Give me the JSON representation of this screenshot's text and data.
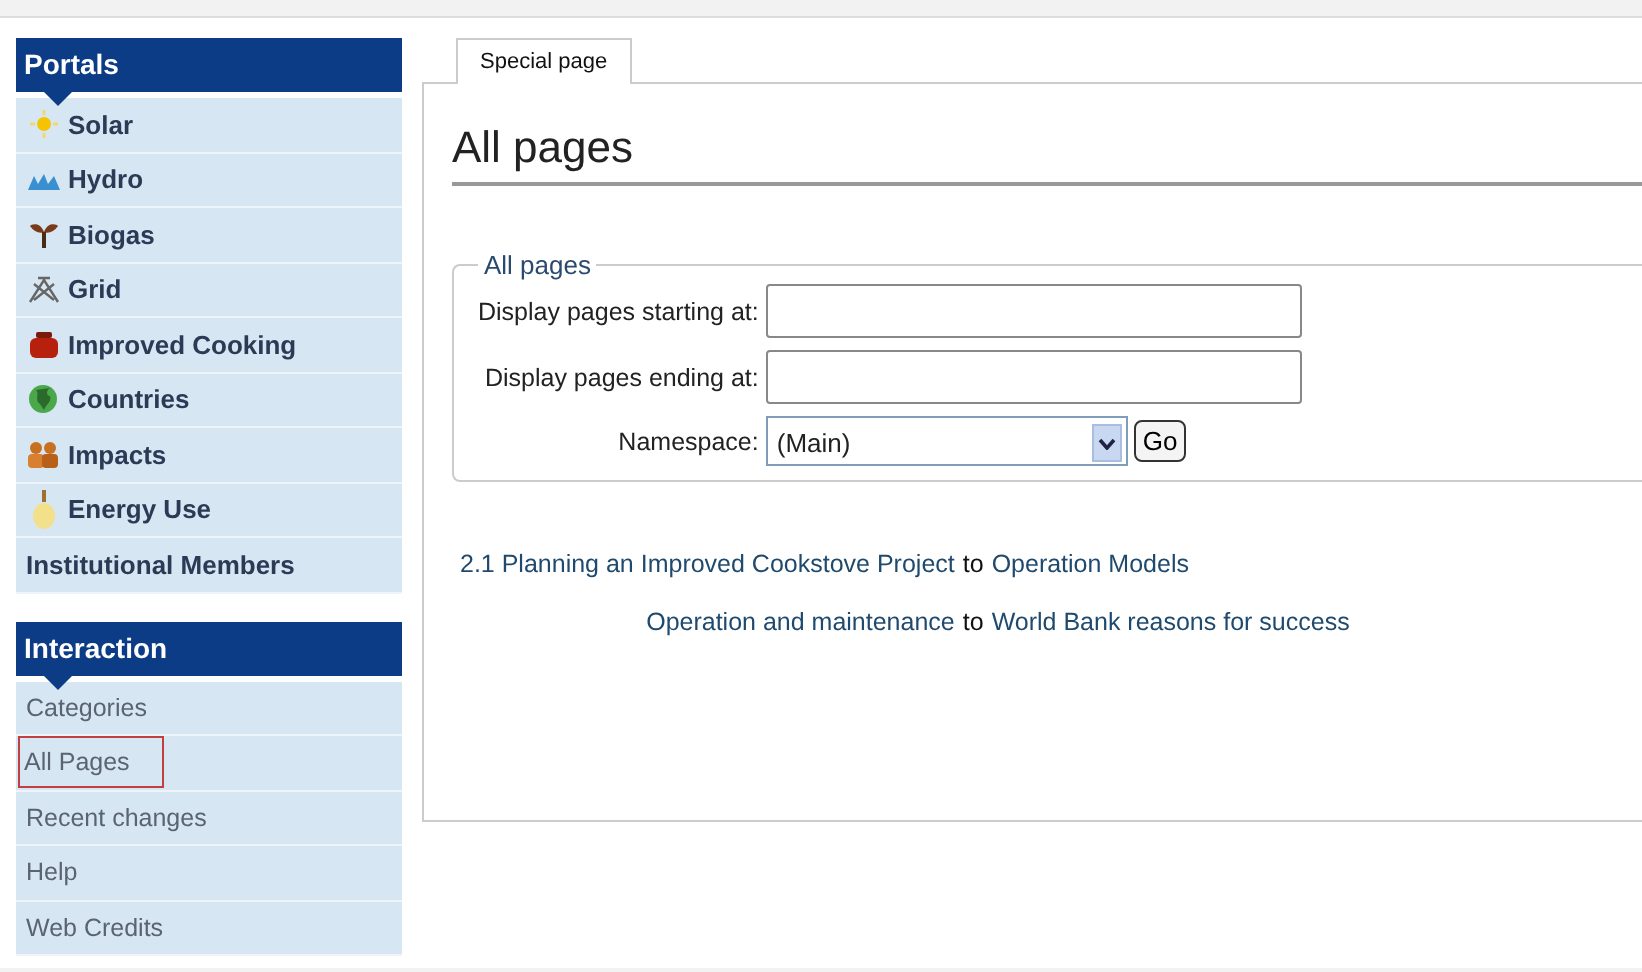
{
  "sidebar": {
    "portals": {
      "title": "Portals",
      "items": [
        {
          "label": "Solar"
        },
        {
          "label": "Hydro"
        },
        {
          "label": "Biogas"
        },
        {
          "label": "Grid"
        },
        {
          "label": "Improved Cooking"
        },
        {
          "label": "Countries"
        },
        {
          "label": "Impacts"
        },
        {
          "label": "Energy Use"
        },
        {
          "label": "Institutional Members"
        }
      ]
    },
    "interaction": {
      "title": "Interaction",
      "items": [
        {
          "label": "Categories",
          "highlighted": false
        },
        {
          "label": "All Pages",
          "highlighted": true
        },
        {
          "label": "Recent changes",
          "highlighted": false
        },
        {
          "label": "Help",
          "highlighted": false
        },
        {
          "label": "Web Credits",
          "highlighted": false
        }
      ]
    }
  },
  "tabs": [
    {
      "label": "Special page",
      "selected": true
    }
  ],
  "heading": "All pages",
  "form": {
    "legend": "All pages",
    "fields": [
      {
        "label": "Display pages starting at:",
        "kind": "text"
      },
      {
        "label": "Display pages ending at:",
        "kind": "text"
      },
      {
        "label": "Namespace:",
        "kind": "select",
        "value": "(Main)",
        "button": "Go"
      }
    ]
  },
  "results": [
    {
      "from": "2.1 Planning an Improved Cookstove Project",
      "joiner": "to",
      "to": "Operation Models"
    },
    {
      "from": "Operation and maintenance",
      "joiner": "to",
      "to": "World Bank reasons for success"
    }
  ]
}
